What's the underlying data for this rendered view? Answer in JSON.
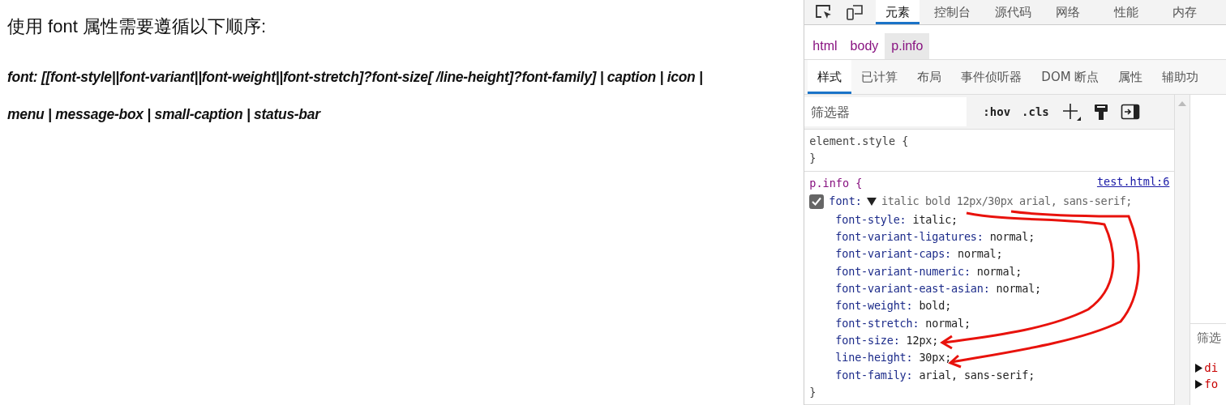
{
  "page": {
    "heading": "使用 font 属性需要遵循以下顺序:",
    "syntax_lines": [
      "font:  [[font-style||font-variant||font-weight||font-stretch]?font-size[ /line-height]?font-family] | caption | icon |",
      "menu | message-box | small-caption | status-bar"
    ]
  },
  "devtools": {
    "main_tabs": [
      {
        "label": "元素",
        "selected": true
      },
      {
        "label": "控制台",
        "selected": false
      },
      {
        "label": "源代码",
        "selected": false
      },
      {
        "label": "网络",
        "selected": false
      },
      {
        "label": "性能",
        "selected": false
      },
      {
        "label": "内存",
        "selected": false
      }
    ],
    "breadcrumbs": [
      {
        "label": "html",
        "selected": false
      },
      {
        "label": "body",
        "selected": false
      },
      {
        "label": "p.info",
        "selected": true
      }
    ],
    "sub_tabs": [
      {
        "label": "样式",
        "selected": true
      },
      {
        "label": "已计算",
        "selected": false
      },
      {
        "label": "布局",
        "selected": false
      },
      {
        "label": "事件侦听器",
        "selected": false
      },
      {
        "label": "DOM 断点",
        "selected": false
      },
      {
        "label": "属性",
        "selected": false
      },
      {
        "label": "辅助功",
        "selected": false
      }
    ],
    "filter": {
      "placeholder": "筛选器"
    },
    "toolbar": [
      ":hov",
      ".cls"
    ],
    "element_style": {
      "selector": "element.style {",
      "close": "}"
    },
    "rule": {
      "selector": "p.info {",
      "source": "test.html:6",
      "shorthand": {
        "name": "font:",
        "value": "italic bold 12px/30px arial, sans-serif;",
        "checked": true,
        "expanded": true
      },
      "longhands": [
        {
          "name": "font-style:",
          "value": "italic;"
        },
        {
          "name": "font-variant-ligatures:",
          "value": "normal;"
        },
        {
          "name": "font-variant-caps:",
          "value": "normal;"
        },
        {
          "name": "font-variant-numeric:",
          "value": "normal;"
        },
        {
          "name": "font-variant-east-asian:",
          "value": "normal;"
        },
        {
          "name": "font-weight:",
          "value": "bold;"
        },
        {
          "name": "font-stretch:",
          "value": "normal;"
        },
        {
          "name": "font-size:",
          "value": "12px;"
        },
        {
          "name": "line-height:",
          "value": "30px;"
        },
        {
          "name": "font-family:",
          "value": "arial, sans-serif;"
        }
      ],
      "close": "}"
    },
    "side_pane": {
      "filter_label": "筛选",
      "rows": [
        "di",
        "fo"
      ]
    }
  }
}
